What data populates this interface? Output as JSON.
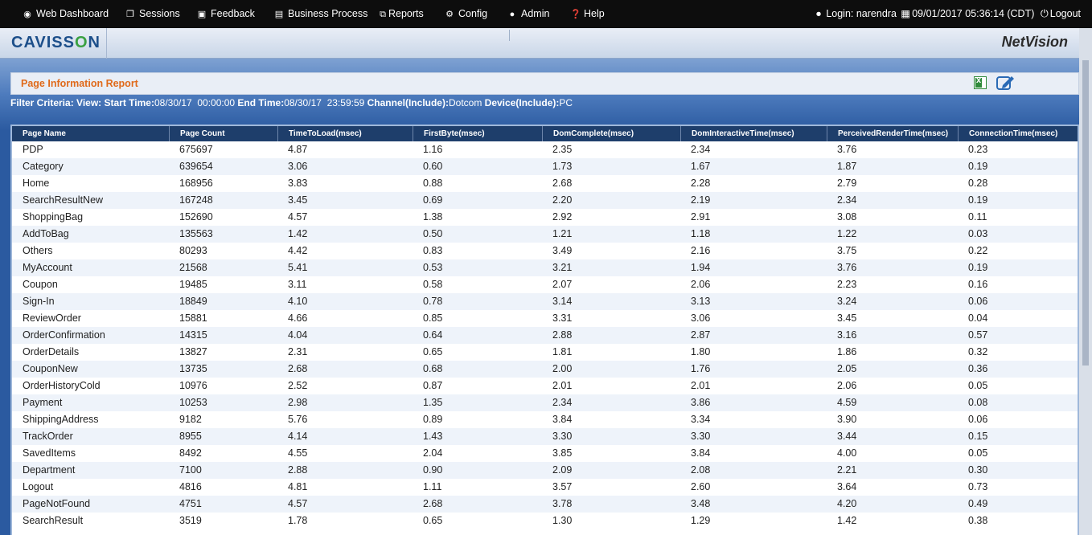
{
  "nav": {
    "items": [
      {
        "label": "Web Dashboard",
        "icon": "dashboard-icon"
      },
      {
        "label": "Sessions",
        "icon": "sessions-icon"
      },
      {
        "label": "Feedback",
        "icon": "feedback-icon"
      },
      {
        "label": "Business Process",
        "icon": "business-process-icon"
      },
      {
        "label": "Reports",
        "icon": "reports-icon"
      },
      {
        "label": "Config",
        "icon": "config-icon"
      },
      {
        "label": "Admin",
        "icon": "admin-icon"
      },
      {
        "label": "Help",
        "icon": "help-icon"
      }
    ],
    "login": "Login: narendra",
    "datetime": "09/01/2017 05:36:14 (CDT)",
    "logout": "Logout"
  },
  "header": {
    "logo_pre": "CAVISS",
    "logo_o": "O",
    "logo_post": "N",
    "product": "NetVision"
  },
  "report": {
    "title": "Page Information Report",
    "filter": {
      "label_criteria": "Filter Criteria:",
      "label_view": "View:",
      "label_start": "Start Time:",
      "start_value": "08/30/17  00:00:00",
      "label_end": "End Time:",
      "end_value": "08/30/17  23:59:59",
      "label_channel": "Channel(Include):",
      "channel_value": "Dotcom",
      "label_device": "Device(Include):",
      "device_value": "PC"
    }
  },
  "table": {
    "columns": [
      "Page Name",
      "Page Count",
      "TimeToLoad(msec)",
      "FirstByte(msec)",
      "DomComplete(msec)",
      "DomInteractiveTime(msec)",
      "PerceivedRenderTime(msec)",
      "ConnectionTime(msec)"
    ],
    "rows": [
      [
        "PDP",
        "675697",
        "4.87",
        "1.16",
        "2.35",
        "2.34",
        "3.76",
        "0.23"
      ],
      [
        "Category",
        "639654",
        "3.06",
        "0.60",
        "1.73",
        "1.67",
        "1.87",
        "0.19"
      ],
      [
        "Home",
        "168956",
        "3.83",
        "0.88",
        "2.68",
        "2.28",
        "2.79",
        "0.28"
      ],
      [
        "SearchResultNew",
        "167248",
        "3.45",
        "0.69",
        "2.20",
        "2.19",
        "2.34",
        "0.19"
      ],
      [
        "ShoppingBag",
        "152690",
        "4.57",
        "1.38",
        "2.92",
        "2.91",
        "3.08",
        "0.11"
      ],
      [
        "AddToBag",
        "135563",
        "1.42",
        "0.50",
        "1.21",
        "1.18",
        "1.22",
        "0.03"
      ],
      [
        "Others",
        "80293",
        "4.42",
        "0.83",
        "3.49",
        "2.16",
        "3.75",
        "0.22"
      ],
      [
        "MyAccount",
        "21568",
        "5.41",
        "0.53",
        "3.21",
        "1.94",
        "3.76",
        "0.19"
      ],
      [
        "Coupon",
        "19485",
        "3.11",
        "0.58",
        "2.07",
        "2.06",
        "2.23",
        "0.16"
      ],
      [
        "Sign-In",
        "18849",
        "4.10",
        "0.78",
        "3.14",
        "3.13",
        "3.24",
        "0.06"
      ],
      [
        "ReviewOrder",
        "15881",
        "4.66",
        "0.85",
        "3.31",
        "3.06",
        "3.45",
        "0.04"
      ],
      [
        "OrderConfirmation",
        "14315",
        "4.04",
        "0.64",
        "2.88",
        "2.87",
        "3.16",
        "0.57"
      ],
      [
        "OrderDetails",
        "13827",
        "2.31",
        "0.65",
        "1.81",
        "1.80",
        "1.86",
        "0.32"
      ],
      [
        "CouponNew",
        "13735",
        "2.68",
        "0.68",
        "2.00",
        "1.76",
        "2.05",
        "0.36"
      ],
      [
        "OrderHistoryCold",
        "10976",
        "2.52",
        "0.87",
        "2.01",
        "2.01",
        "2.06",
        "0.05"
      ],
      [
        "Payment",
        "10253",
        "2.98",
        "1.35",
        "2.34",
        "3.86",
        "4.59",
        "0.08"
      ],
      [
        "ShippingAddress",
        "9182",
        "5.76",
        "0.89",
        "3.84",
        "3.34",
        "3.90",
        "0.06"
      ],
      [
        "TrackOrder",
        "8955",
        "4.14",
        "1.43",
        "3.30",
        "3.30",
        "3.44",
        "0.15"
      ],
      [
        "SavedItems",
        "8492",
        "4.55",
        "2.04",
        "3.85",
        "3.84",
        "4.00",
        "0.05"
      ],
      [
        "Department",
        "7100",
        "2.88",
        "0.90",
        "2.09",
        "2.08",
        "2.21",
        "0.30"
      ],
      [
        "Logout",
        "4816",
        "4.81",
        "1.11",
        "3.57",
        "2.60",
        "3.64",
        "0.73"
      ],
      [
        "PageNotFound",
        "4751",
        "4.57",
        "2.68",
        "3.78",
        "3.48",
        "4.20",
        "0.49"
      ],
      [
        "SearchResult",
        "3519",
        "1.78",
        "0.65",
        "1.30",
        "1.29",
        "1.42",
        "0.38"
      ]
    ]
  }
}
